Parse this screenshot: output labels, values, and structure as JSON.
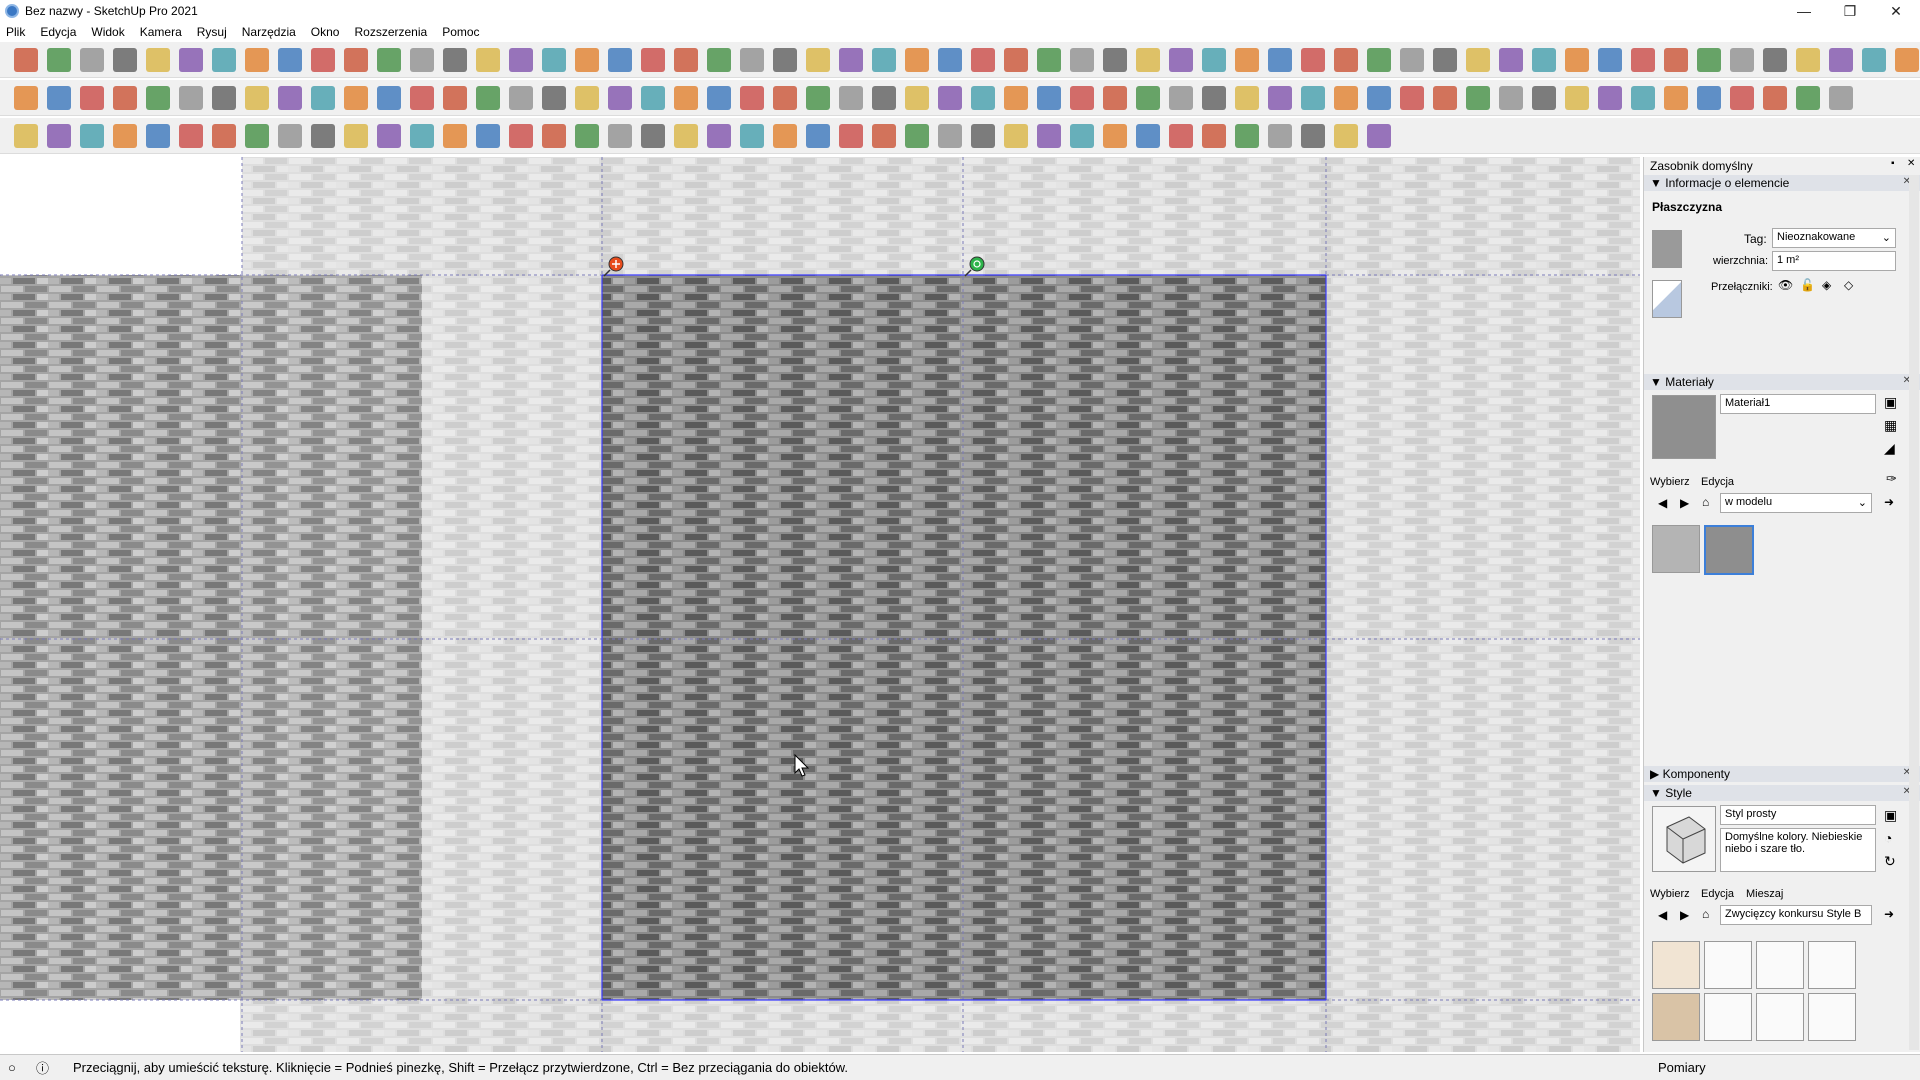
{
  "window": {
    "title": "Bez nazwy - SketchUp Pro 2021"
  },
  "menu": [
    "Plik",
    "Edycja",
    "Widok",
    "Kamera",
    "Rysuj",
    "Narzędzia",
    "Okno",
    "Rozszerzenia",
    "Pomoc"
  ],
  "tray": {
    "title": "Zasobnik domyślny",
    "entity_info": {
      "header": "Informacje o elemencie",
      "type": "Płaszczyzna",
      "tag_label": "Tag:",
      "tag_value": "Nieoznakowane",
      "area_label": "wierzchnia:",
      "area_value": "1 m²",
      "toggles_label": "Przełączniki:"
    },
    "materials": {
      "header": "Materiały",
      "name": "Materiał1",
      "tab_select": "Wybierz",
      "tab_edit": "Edycja",
      "collection": "w modelu"
    },
    "components": {
      "header": "Komponenty"
    },
    "styles": {
      "header": "Style",
      "name": "Styl prosty",
      "description": "Domyślne kolory. Niebieskie niebo i szare tło.",
      "tab_select": "Wybierz",
      "tab_edit": "Edycja",
      "tab_mix": "Mieszaj",
      "collection": "Zwycięzcy konkursu Style B"
    }
  },
  "status": {
    "hint": "Przeciągnij, aby umieścić teksturę.  Kliknięcie = Podnieś pinezkę, Shift = Przełącz przytwierdzone, Ctrl = Bez przeciągania do obiektów.",
    "measurements_label": "Pomiary"
  },
  "colors": {
    "accent": "#3c7fd9",
    "pin_red": "#e84c1c",
    "pin_green": "#2db34a"
  }
}
